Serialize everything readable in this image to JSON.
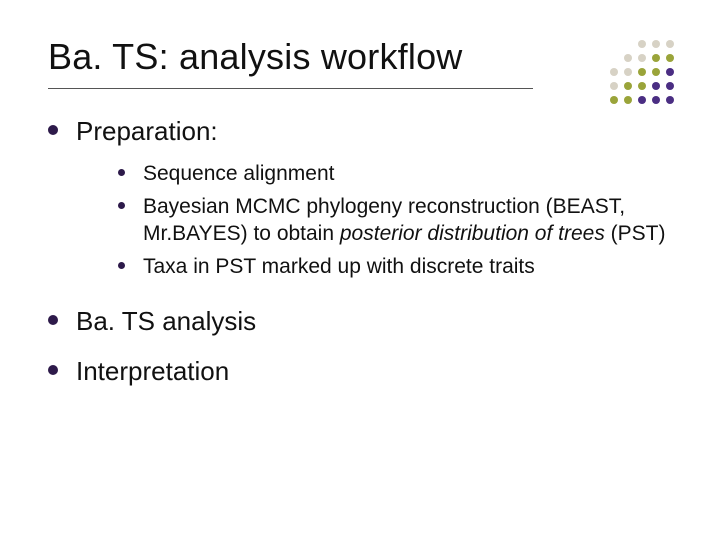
{
  "title": "Ba. TS: analysis workflow",
  "bullets": [
    {
      "label": "Preparation:",
      "sub": [
        {
          "html": "Sequence alignment"
        },
        {
          "html": "Bayesian MCMC phylogeny reconstruction (BEAST, Mr.BAYES) to obtain <em>posterior distribution of trees</em> (PST)"
        },
        {
          "html": "Taxa in PST marked up with discrete traits"
        }
      ]
    },
    {
      "label": "Ba. TS analysis"
    },
    {
      "label": "Interpretation"
    }
  ],
  "dot_colors": {
    "purple": "#4b2e83",
    "olive": "#9aa43a",
    "grey": "#d7d2c5"
  },
  "dot_grid": [
    [
      "",
      "",
      "grey",
      "grey",
      "grey"
    ],
    [
      "",
      "grey",
      "grey",
      "olive",
      "olive"
    ],
    [
      "grey",
      "grey",
      "olive",
      "olive",
      "purple"
    ],
    [
      "grey",
      "olive",
      "olive",
      "purple",
      "purple"
    ],
    [
      "olive",
      "olive",
      "purple",
      "purple",
      "purple"
    ]
  ]
}
